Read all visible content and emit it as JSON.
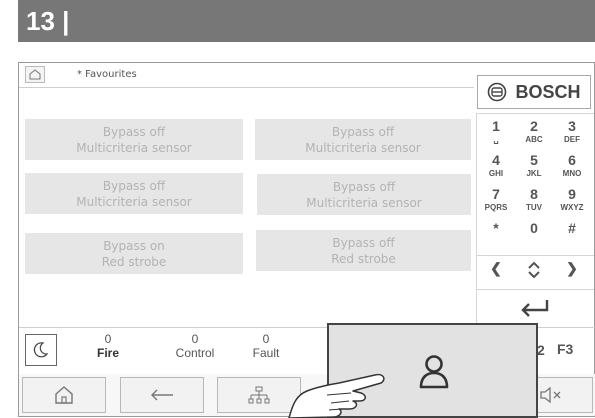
{
  "page": {
    "number": "13 |"
  },
  "tab": {
    "label": "* Favourites"
  },
  "favourites": [
    {
      "line1": "Bypass off",
      "line2": "Multicriteria sensor"
    },
    {
      "line1": "Bypass off",
      "line2": "Multicriteria sensor"
    },
    {
      "line1": "Bypass off",
      "line2": "Multicriteria sensor"
    },
    {
      "line1": "Bypass off",
      "line2": "Multicriteria sensor"
    },
    {
      "line1": "Bypass on",
      "line2": "Red strobe"
    },
    {
      "line1": "Bypass off",
      "line2": "Red strobe"
    }
  ],
  "logo": {
    "text": "BOSCH"
  },
  "keypad": {
    "k1": {
      "d": "1",
      "l": "␣"
    },
    "k2": {
      "d": "2",
      "l": "ABC"
    },
    "k3": {
      "d": "3",
      "l": "DEF"
    },
    "k4": {
      "d": "4",
      "l": "GHI"
    },
    "k5": {
      "d": "5",
      "l": "JKL"
    },
    "k6": {
      "d": "6",
      "l": "MNO"
    },
    "k7": {
      "d": "7",
      "l": "PQRS"
    },
    "k8": {
      "d": "8",
      "l": "TUV"
    },
    "k9": {
      "d": "9",
      "l": "WXYZ"
    },
    "kstar": "*",
    "k0": "0",
    "khash": "#",
    "left": "❮",
    "right": "❯"
  },
  "status": {
    "fire": {
      "count": "0",
      "label": "Fire"
    },
    "control": {
      "count": "0",
      "label": "Control"
    },
    "fault": {
      "count": "0",
      "label": "Fault"
    },
    "partial_key": "2",
    "f3": "F3"
  },
  "icons": [
    "home-icon",
    "back-arrow-icon",
    "network-icon",
    "mute-icon",
    "moon-icon",
    "user-icon",
    "enter-icon",
    "updown-icon"
  ],
  "colors": {
    "header_bar": "#777777",
    "button_bg": "#e6e6e6",
    "button_text": "#b3b3b3",
    "overlay_bg": "#e2e2e2"
  }
}
